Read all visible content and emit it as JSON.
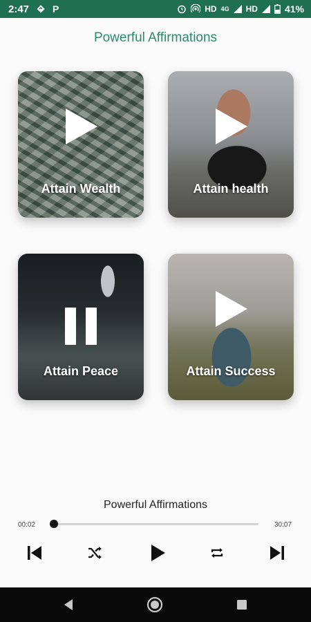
{
  "status_bar": {
    "time": "2:47",
    "left_icons": [
      "navigation-diamond-icon",
      "parking-p-icon"
    ],
    "right_icons": [
      "alarm-icon",
      "hotspot-icon",
      "hd-label",
      "4g-signal-icon",
      "hd-label",
      "signal-icon",
      "battery-icon"
    ],
    "hd1": "HD",
    "network": "4G",
    "hd2": "HD",
    "battery": "41%",
    "p_label": "P"
  },
  "header": {
    "title": "Powerful Affirmations"
  },
  "cards": [
    {
      "label": "Attain Wealth",
      "state": "play",
      "icon": "play-icon"
    },
    {
      "label": "Attain health",
      "state": "play",
      "icon": "play-icon"
    },
    {
      "label": "Attain Peace",
      "state": "pause",
      "icon": "pause-icon"
    },
    {
      "label": "Attain Success",
      "state": "play",
      "icon": "play-icon"
    }
  ],
  "player": {
    "title": "Powerful Affirmations",
    "elapsed": "00:02",
    "total": "30:07",
    "progress": 0.0011,
    "controls": [
      "skip-previous-icon",
      "shuffle-icon",
      "play-icon",
      "repeat-icon",
      "skip-next-icon"
    ]
  },
  "nav_bar": {
    "buttons": [
      "back-icon",
      "home-icon",
      "recents-icon"
    ]
  },
  "colors": {
    "status_bar": "#1f6f52",
    "accent": "#2a8a6c",
    "background": "#fafafa"
  }
}
